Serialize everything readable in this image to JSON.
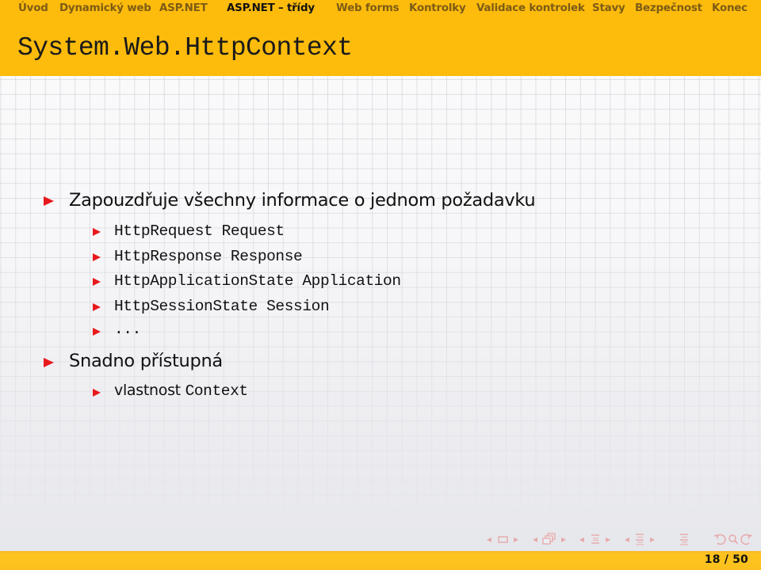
{
  "nav": {
    "items": [
      {
        "label": "Úvod",
        "active": false
      },
      {
        "label": "Dynamický web",
        "active": false
      },
      {
        "label": "ASP.NET",
        "active": false
      },
      {
        "label": "ASP.NET – třídy",
        "active": true
      },
      {
        "label": "Web forms",
        "active": false
      },
      {
        "label": "Kontrolky",
        "active": false
      },
      {
        "label": "Validace kontrolek",
        "active": false
      },
      {
        "label": "Stavy",
        "active": false
      },
      {
        "label": "Bezpečnost",
        "active": false
      },
      {
        "label": "Konec",
        "active": false
      }
    ]
  },
  "slide": {
    "title": "System.Web.HttpContext",
    "bullets": [
      {
        "text": "Zapouzdřuje všechny informace o jednom požadavku",
        "sub": [
          {
            "code": "HttpRequest Request"
          },
          {
            "code": "HttpResponse Response"
          },
          {
            "code": "HttpApplicationState Application"
          },
          {
            "code": "HttpSessionState Session"
          },
          {
            "code": "..."
          }
        ]
      },
      {
        "text": "Snadno přístupná",
        "sub": [
          {
            "text": "vlastnost ",
            "code": "Context"
          }
        ]
      }
    ]
  },
  "navigation_symbols": {
    "color": "#e7a9ab",
    "icons": [
      "arrow-left",
      "frame",
      "arrow-right",
      "arrow-left",
      "subsection",
      "arrow-right",
      "arrow-left",
      "section",
      "arrow-right",
      "arrow-left",
      "subsection-list",
      "arrow-right",
      "align",
      "back",
      "search",
      "forward"
    ]
  },
  "footer": {
    "page_current": "18",
    "page_total": "50",
    "page_label": "18 / 50"
  },
  "colors": {
    "header": "#fdbb0c",
    "bullet": "#e8191c",
    "nav_text": "#7d5c14",
    "nav_active": "#111111"
  }
}
